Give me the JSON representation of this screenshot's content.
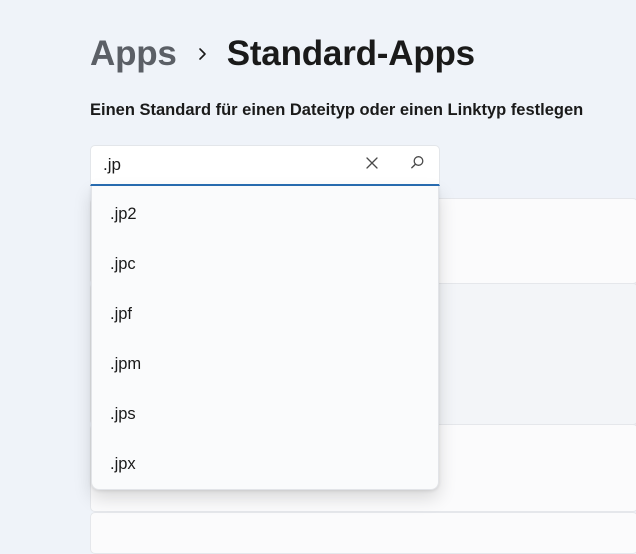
{
  "breadcrumb": {
    "parent": "Apps",
    "current": "Standard-Apps"
  },
  "section": {
    "label": "Einen Standard für einen Dateityp oder einen Linktyp festlegen"
  },
  "search": {
    "value": ".jp",
    "clear_icon": "close-icon",
    "search_icon": "search-icon"
  },
  "suggestions": [
    {
      "label": ".jp2"
    },
    {
      "label": ".jpc"
    },
    {
      "label": ".jpf"
    },
    {
      "label": ".jpm"
    },
    {
      "label": ".jps"
    },
    {
      "label": ".jpx"
    }
  ],
  "colors": {
    "accent": "#2a6fb5",
    "background": "#eff3f9"
  }
}
